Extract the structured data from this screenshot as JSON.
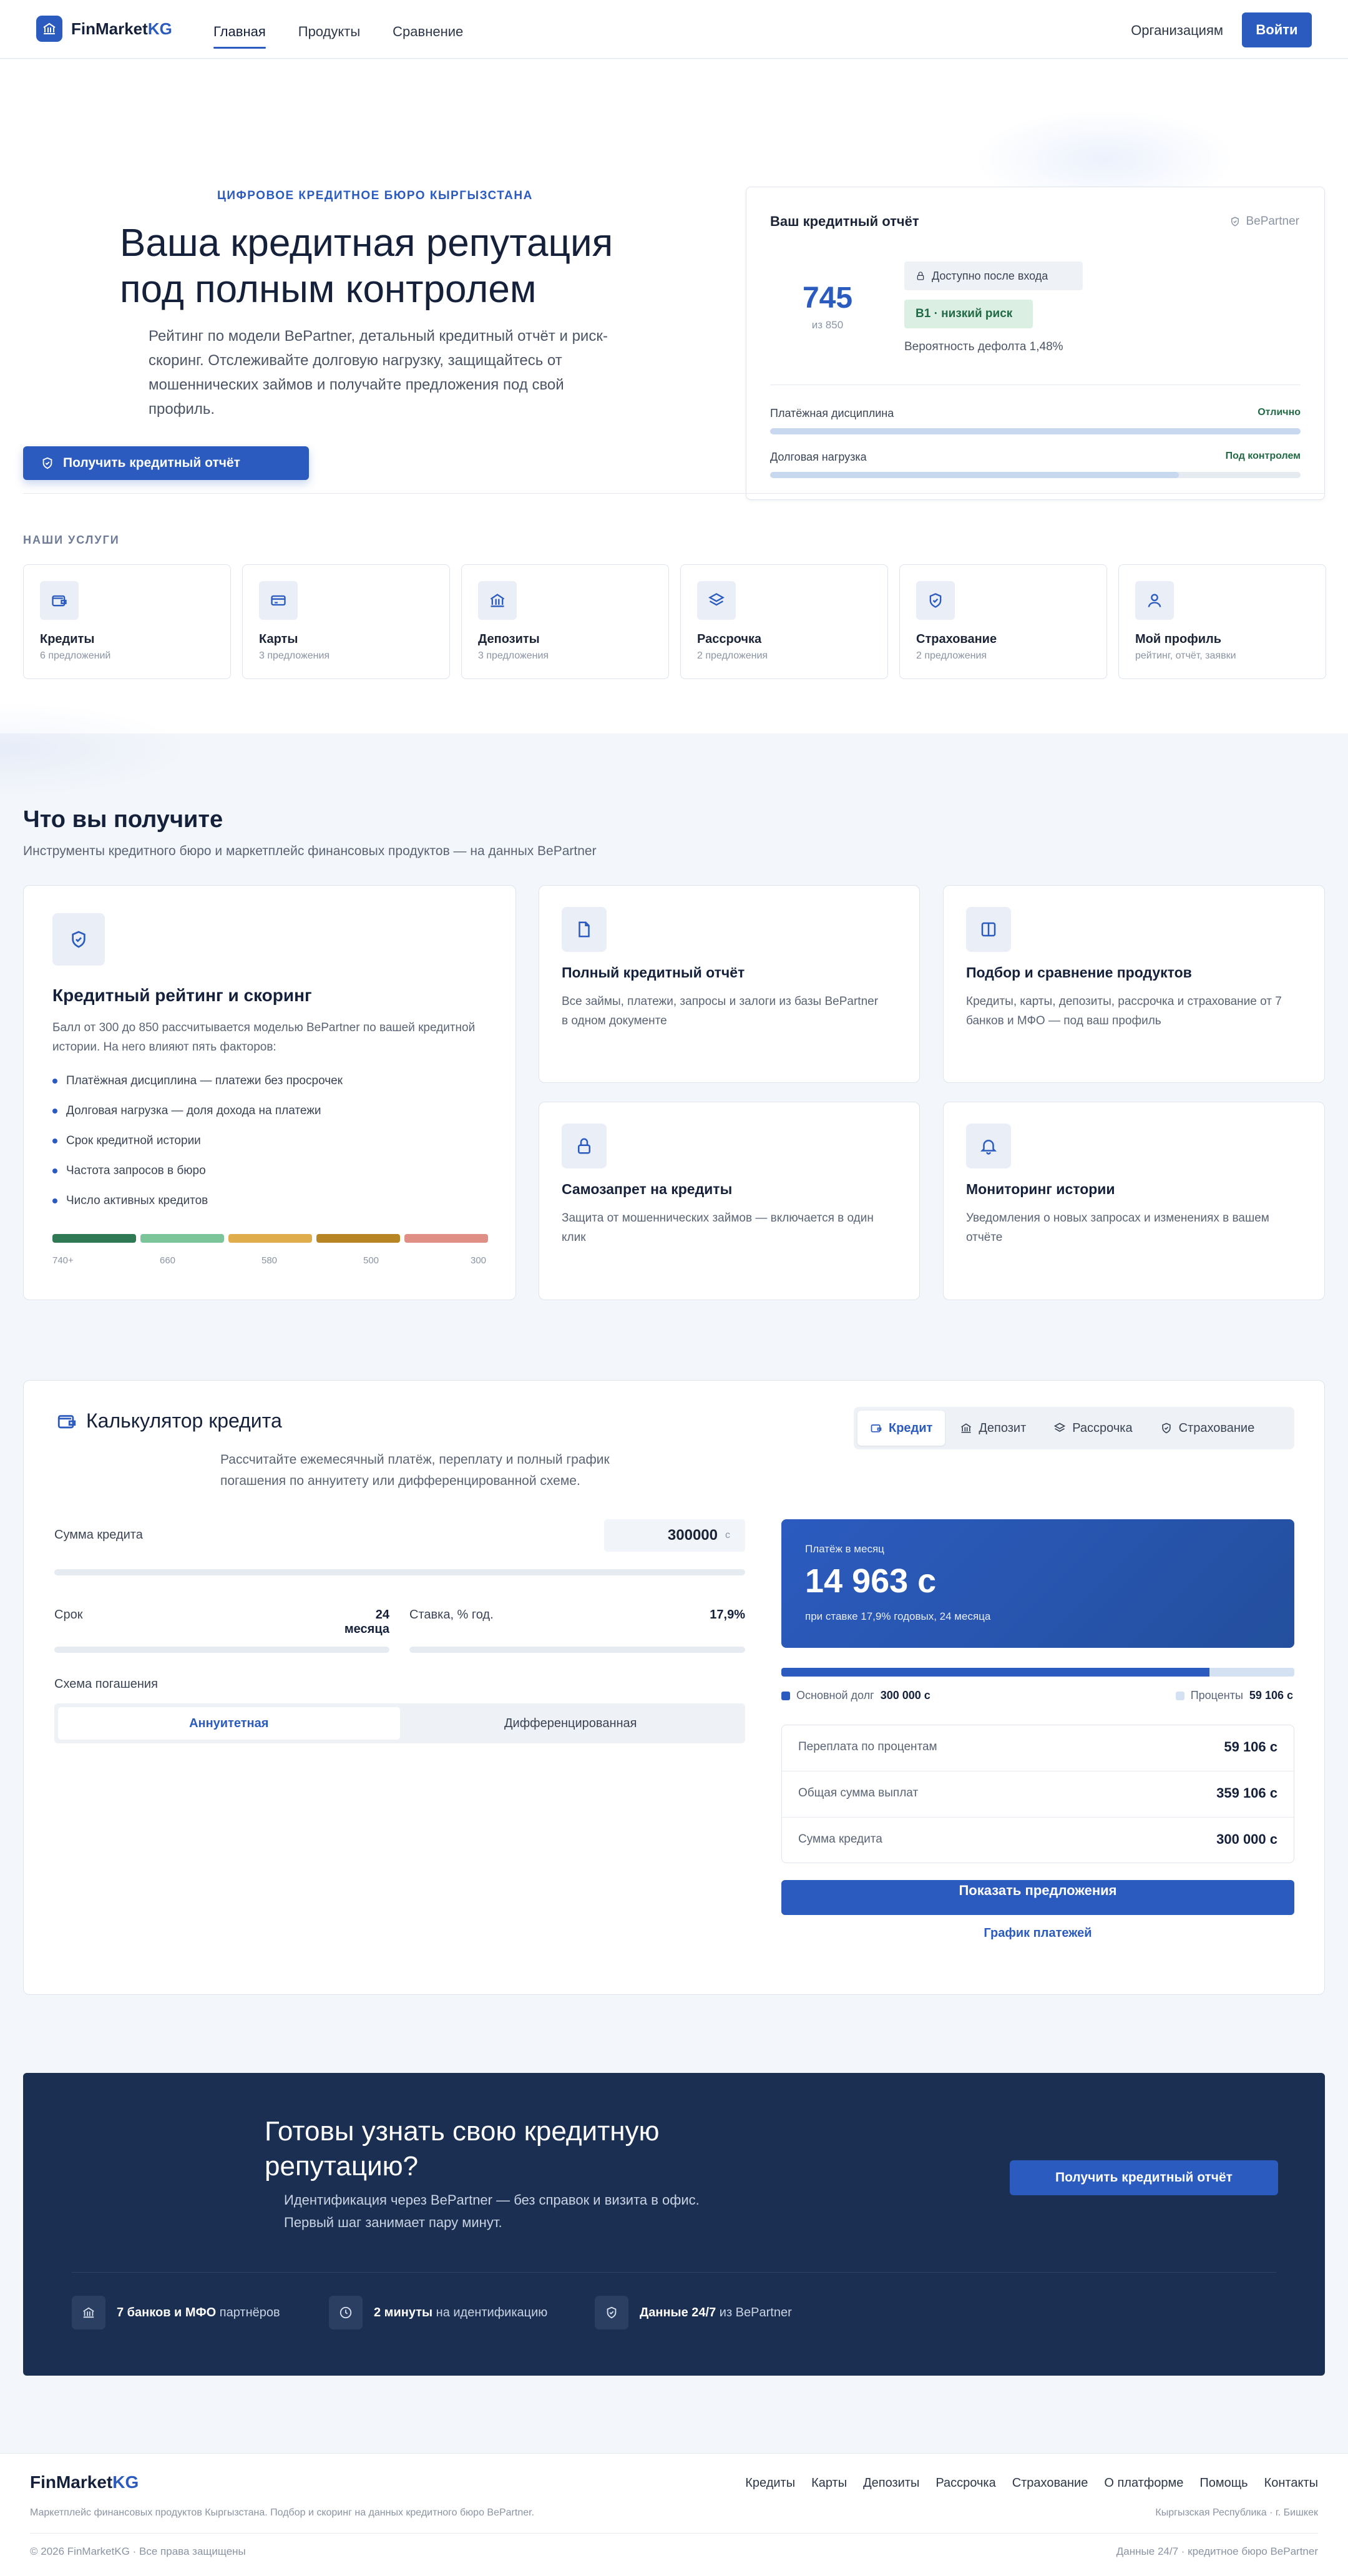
{
  "header": {
    "logo_main": "FinMarket",
    "logo_accent": "KG",
    "nav": [
      "Главная",
      "Продукты",
      "Сравнение"
    ],
    "org_link": "Организациям",
    "login": "Войти"
  },
  "hero": {
    "eyebrow": "ЦИФРОВОЕ КРЕДИТНОЕ БЮРО КЫРГЫЗСТАНА",
    "title": "Ваша кредитная репутация под полным контролем",
    "description": "Рейтинг по модели BePartner, детальный кредитный отчёт и риск-скоринг. Отслеживайте долговую нагрузку, защищайтесь от мошеннических займов и получайте предложения под свой профиль.",
    "cta": "Получить кредитный отчёт"
  },
  "report": {
    "title": "Ваш кредитный отчёт",
    "provider": "BePartner",
    "score": "745",
    "score_of": "из 850",
    "locked_label": "Доступно после входа",
    "risk": "B1 · низкий риск",
    "default_prob": "Вероятность дефолта 1,48%",
    "bars": [
      {
        "label": "Платёжная дисциплина",
        "status": "Отлично",
        "fill": 1.0
      },
      {
        "label": "Долговая нагрузка",
        "status": "Под контролем",
        "fill": 0.77
      }
    ]
  },
  "services": {
    "heading": "НАШИ УСЛУГИ",
    "items": [
      {
        "name": "Кредиты",
        "sub": "6 предложений",
        "icon": "wallet-icon"
      },
      {
        "name": "Карты",
        "sub": "3 предложения",
        "icon": "card-icon"
      },
      {
        "name": "Депозиты",
        "sub": "3 предложения",
        "icon": "bank-icon"
      },
      {
        "name": "Рассрочка",
        "sub": "2 предложения",
        "icon": "layers-icon"
      },
      {
        "name": "Страхование",
        "sub": "2 предложения",
        "icon": "shield-icon"
      },
      {
        "name": "Мой профиль",
        "sub": "рейтинг, отчёт, заявки",
        "icon": "user-icon"
      }
    ]
  },
  "features": {
    "title": "Что вы получите",
    "subtitle": "Инструменты кредитного бюро и маркетплейс финансовых продуктов — на данных BePartner",
    "main": {
      "title": "Кредитный рейтинг и скоринг",
      "desc": "Балл от 300 до 850 рассчитывается моделью BePartner по вашей кредитной истории. На него влияют пять факторов:",
      "bullets": [
        "Платёжная дисциплина — платежи без просрочек",
        "Долговая нагрузка — доля дохода на платежи",
        "Срок кредитной истории",
        "Частота запросов в бюро",
        "Число активных кредитов"
      ],
      "scale": [
        "740+",
        "660",
        "580",
        "500",
        "300"
      ],
      "scale_colors": [
        "#2f7a55",
        "#7cc49a",
        "#e0ad4c",
        "#b88524",
        "#e08f85"
      ]
    },
    "cards": [
      {
        "title": "Полный кредитный отчёт",
        "desc": "Все займы, платежи, запросы и залоги из базы BePartner в одном документе",
        "icon": "document-icon"
      },
      {
        "title": "Подбор и сравнение продуктов",
        "desc": "Кредиты, карты, депозиты, рассрочка и страхование от 7 банков и МФО — под ваш профиль",
        "icon": "columns-icon"
      },
      {
        "title": "Самозапрет на кредиты",
        "desc": "Защита от мошеннических займов — включается в один клик",
        "icon": "lock-icon"
      },
      {
        "title": "Мониторинг истории",
        "desc": "Уведомления о новых запросах и изменениях в вашем отчёте",
        "icon": "bell-icon"
      }
    ]
  },
  "calculator": {
    "title": "Калькулятор кредита",
    "desc": "Рассчитайте ежемесячный платёж, переплату и полный график погашения по аннуитету или дифференцированной схеме.",
    "tabs": [
      "Кредит",
      "Депозит",
      "Рассрочка",
      "Страхование"
    ],
    "amount_label": "Сумма кредита",
    "amount_value": "300000",
    "currency": "с",
    "term_label": "Срок",
    "term_value": "24 месяца",
    "rate_label": "Ставка, % год.",
    "rate_value": "17,9%",
    "scheme_label": "Схема погашения",
    "schemes": [
      "Аннуитетная",
      "Дифференцированная"
    ],
    "payment_label": "Платёж в месяц",
    "payment_value": "14 963 с",
    "payment_note": "при ставке 17,9% годовых, 24 месяца",
    "principal_share": 0.835,
    "legend_principal": "Основной долг",
    "legend_principal_value": "300 000 с",
    "legend_interest": "Проценты",
    "legend_interest_value": "59 106 с",
    "summary": [
      {
        "label": "Переплата по процентам",
        "value": "59 106 с"
      },
      {
        "label": "Общая сумма выплат",
        "value": "359 106 с"
      },
      {
        "label": "Сумма кредита",
        "value": "300 000 с"
      }
    ],
    "offers_btn": "Показать предложения",
    "schedule_link": "График платежей"
  },
  "cta": {
    "title": "Готовы узнать свою кредитную репутацию?",
    "desc": "Идентификация через BePartner — без справок и визита в офис. Первый шаг занимает пару минут.",
    "button": "Получить кредитный отчёт",
    "facts": [
      {
        "bold": "7 банков и МФО",
        "rest": "партнёров",
        "icon": "bank-icon"
      },
      {
        "bold": "2 минуты",
        "rest": "на идентификацию",
        "icon": "clock-icon"
      },
      {
        "bold": "Данные 24/7",
        "rest": "из BePartner",
        "icon": "shield-icon"
      }
    ]
  },
  "footer": {
    "logo_main": "FinMarket",
    "logo_accent": "KG",
    "nav": [
      "Кредиты",
      "Карты",
      "Депозиты",
      "Рассрочка",
      "Страхование",
      "О платформе",
      "Помощь",
      "Контакты"
    ],
    "desc": "Маркетплейс финансовых продуктов Кыргызстана. Подбор и скоринг на данных кредитного бюро BePartner.",
    "location": "Кыргызская Республика · г. Бишкек",
    "copyright": "© 2026 FinMarketKG · Все права защищены",
    "right_note": "Данные 24/7 · кредитное бюро BePartner"
  }
}
